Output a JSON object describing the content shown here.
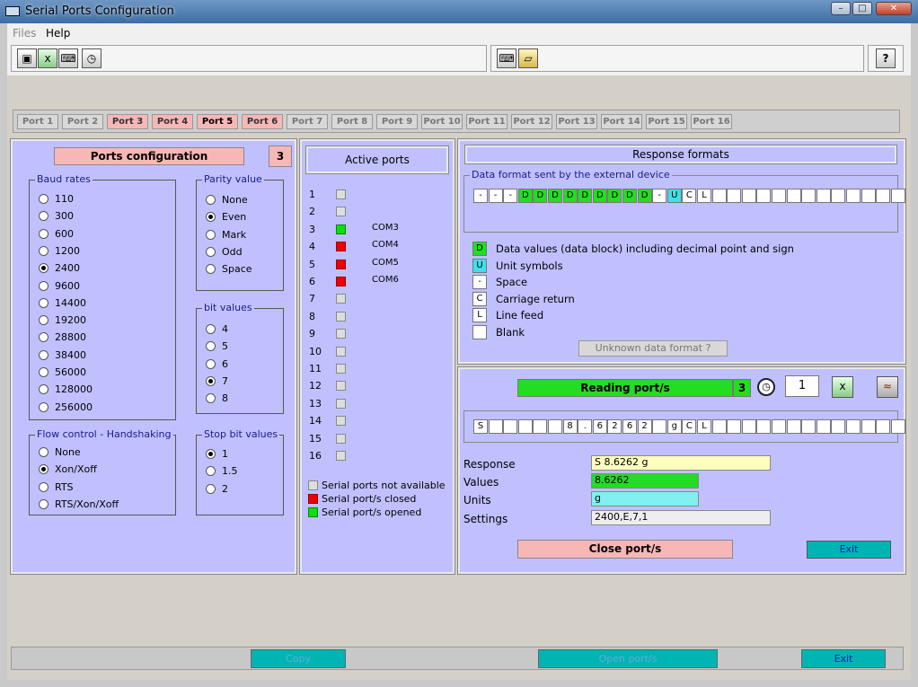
{
  "window": {
    "title": "Serial Ports Configuration",
    "min": "–",
    "max": "□",
    "close": "✕"
  },
  "menu": {
    "files": "Files",
    "help": "Help"
  },
  "toolbar": {
    "help_icon": "?"
  },
  "ports_tabs": [
    "Port 1",
    "Port 2",
    "Port 3",
    "Port 4",
    "Port 5",
    "Port 6",
    "Port 7",
    "Port 8",
    "Port 9",
    "Port 10",
    "Port 11",
    "Port 12",
    "Port 13",
    "Port 14",
    "Port 15",
    "Port 16"
  ],
  "config": {
    "button": "Ports configuration",
    "count": "3",
    "baud_title": "Baud rates",
    "baud_rates": [
      "110",
      "300",
      "600",
      "1200",
      "2400",
      "9600",
      "14400",
      "19200",
      "28800",
      "38400",
      "56000",
      "128000",
      "256000"
    ],
    "baud_selected": "2400",
    "parity_title": "Parity value",
    "parity": [
      "None",
      "Even",
      "Mark",
      "Odd",
      "Space"
    ],
    "parity_selected": "Even",
    "bits_title": "bit values",
    "bits": [
      "4",
      "5",
      "6",
      "7",
      "8"
    ],
    "bits_selected": "7",
    "stop_title": "Stop bit values",
    "stop": [
      "1",
      "1.5",
      "2"
    ],
    "stop_selected": "1",
    "flow_title": "Flow control - Handshaking",
    "flow": [
      "None",
      "Xon/Xoff",
      "RTS",
      "RTS/Xon/Xoff"
    ],
    "flow_selected": "Xon/Xoff"
  },
  "active": {
    "title": "Active ports",
    "rows": [
      {
        "n": "1",
        "state": "na",
        "com": ""
      },
      {
        "n": "2",
        "state": "na",
        "com": ""
      },
      {
        "n": "3",
        "state": "open",
        "com": "COM3"
      },
      {
        "n": "4",
        "state": "closed",
        "com": "COM4"
      },
      {
        "n": "5",
        "state": "closed",
        "com": "COM5"
      },
      {
        "n": "6",
        "state": "closed",
        "com": "COM6"
      },
      {
        "n": "7",
        "state": "na",
        "com": ""
      },
      {
        "n": "8",
        "state": "na",
        "com": ""
      },
      {
        "n": "9",
        "state": "na",
        "com": ""
      },
      {
        "n": "10",
        "state": "na",
        "com": ""
      },
      {
        "n": "11",
        "state": "na",
        "com": ""
      },
      {
        "n": "12",
        "state": "na",
        "com": ""
      },
      {
        "n": "13",
        "state": "na",
        "com": ""
      },
      {
        "n": "14",
        "state": "na",
        "com": ""
      },
      {
        "n": "15",
        "state": "na",
        "com": ""
      },
      {
        "n": "16",
        "state": "na",
        "com": ""
      }
    ],
    "legend_na": "Serial ports not available",
    "legend_closed": "Serial port/s closed",
    "legend_open": "Serial port/s opened"
  },
  "formats": {
    "title": "Response formats",
    "group_title": "Data format sent by the external device",
    "cells": [
      "-",
      "-",
      "-",
      "D",
      "D",
      "D",
      "D",
      "D",
      "D",
      "D",
      "D",
      "D",
      "-",
      "U",
      "C",
      "L",
      "",
      "",
      "",
      "",
      "",
      "",
      "",
      "",
      "",
      "",
      "",
      "",
      ""
    ],
    "legend": [
      {
        "sym": "D",
        "kind": "d",
        "text": "Data values (data block) including decimal point and sign"
      },
      {
        "sym": "U",
        "kind": "u",
        "text": "Unit symbols"
      },
      {
        "sym": "-",
        "kind": "",
        "text": "Space"
      },
      {
        "sym": "C",
        "kind": "",
        "text": "Carriage return"
      },
      {
        "sym": "L",
        "kind": "",
        "text": "Line feed"
      },
      {
        "sym": "",
        "kind": "",
        "text": "Blank"
      }
    ],
    "unknown_button": "Unknown data format ?"
  },
  "reading": {
    "bar": "Reading port/s",
    "count": "3",
    "timer_value": "1",
    "cells": [
      "S",
      "",
      "",
      "",
      "",
      "",
      "8",
      ".",
      "6",
      "2",
      "6",
      "2",
      "",
      "g",
      "C",
      "L",
      "",
      "",
      "",
      "",
      "",
      "",
      "",
      "",
      "",
      "",
      "",
      "",
      ""
    ],
    "response_label": "Response",
    "response_value": "S    8.6262 g",
    "values_label": "Values",
    "values_value": "8.6262",
    "units_label": "Units",
    "units_value": "g",
    "settings_label": "Settings",
    "settings_value": "2400,E,7,1",
    "close_button": "Close port/s",
    "exit_button": "Exit"
  },
  "bottom": {
    "copy": "Copy",
    "open": "Open port/s",
    "exit": "Exit"
  },
  "colors": {
    "panel": "#c0c0ff",
    "green": "#22dd22",
    "pink": "#f8b7b7",
    "teal": "#00b4b4"
  }
}
